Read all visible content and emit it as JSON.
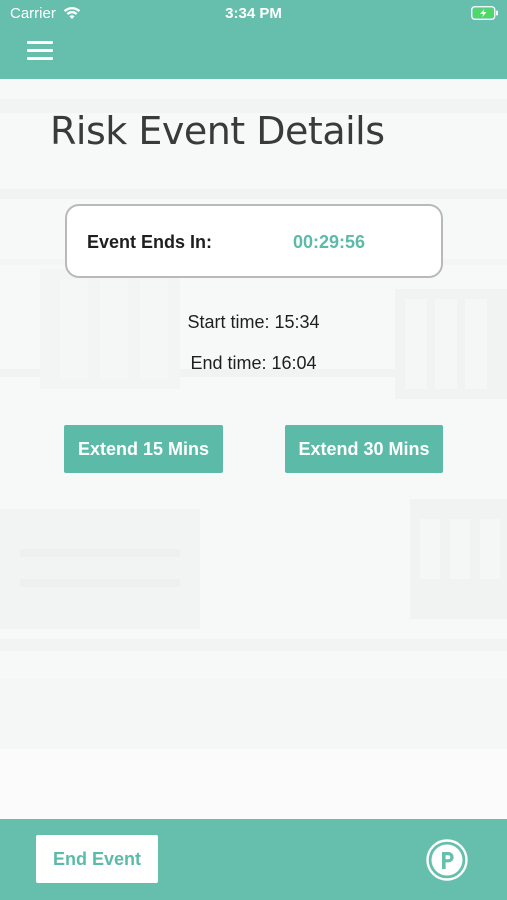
{
  "status_bar": {
    "carrier": "Carrier",
    "time": "3:34 PM",
    "icons": [
      "wifi-icon",
      "battery-charging-icon"
    ]
  },
  "header": {
    "menu_icon": "hamburger-menu-icon",
    "color": "#66bfad"
  },
  "page": {
    "title": "Risk Event Details"
  },
  "timer": {
    "label": "Event Ends In:",
    "value": "00:29:56",
    "value_color": "#5cbba8"
  },
  "times": {
    "start": "Start time: 15:34",
    "end": "End time: 16:04"
  },
  "actions": {
    "extend_15": "Extend 15 Mins",
    "extend_30": "Extend 30 Mins",
    "button_color": "#5cbba8"
  },
  "footer": {
    "end_event": "End Event",
    "logo_icon": "p-logo-icon"
  }
}
